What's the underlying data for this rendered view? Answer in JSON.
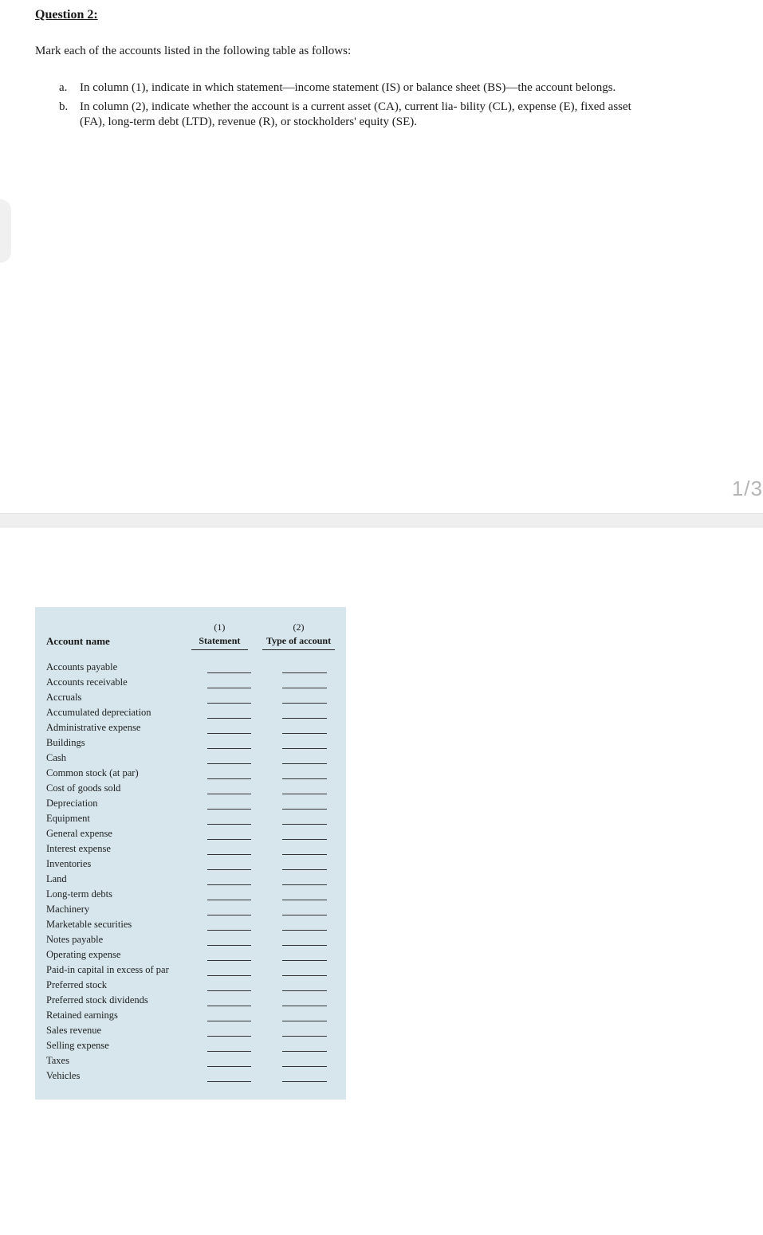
{
  "question": {
    "title": "Question 2:",
    "intro": "Mark each of the accounts listed in the following table as follows:",
    "items": [
      {
        "marker": "a.",
        "text": "In column (1), indicate in which statement—income statement (IS) or balance sheet (BS)—the account belongs."
      },
      {
        "marker": "b.",
        "text": "In column (2), indicate whether the account is a current asset (CA), current lia- bility (CL), expense (E), fixed asset (FA), long-term debt (LTD), revenue (R), or stockholders' equity (SE)."
      }
    ]
  },
  "page_indicator": "1/3",
  "table": {
    "header": {
      "name": "Account name",
      "col1_num": "(1)",
      "col1_label": "Statement",
      "col2_num": "(2)",
      "col2_label": "Type of account"
    },
    "rows": [
      "Accounts payable",
      "Accounts receivable",
      "Accruals",
      "Accumulated depreciation",
      "Administrative expense",
      "Buildings",
      "Cash",
      "Common stock (at par)",
      "Cost of goods sold",
      "Depreciation",
      "Equipment",
      "General expense",
      "Interest expense",
      "Inventories",
      "Land",
      "Long-term debts",
      "Machinery",
      "Marketable securities",
      "Notes payable",
      "Operating expense",
      "Paid-in capital in excess of par",
      "Preferred stock",
      "Preferred stock dividends",
      "Retained earnings",
      "Sales revenue",
      "Selling expense",
      "Taxes",
      "Vehicles"
    ]
  }
}
